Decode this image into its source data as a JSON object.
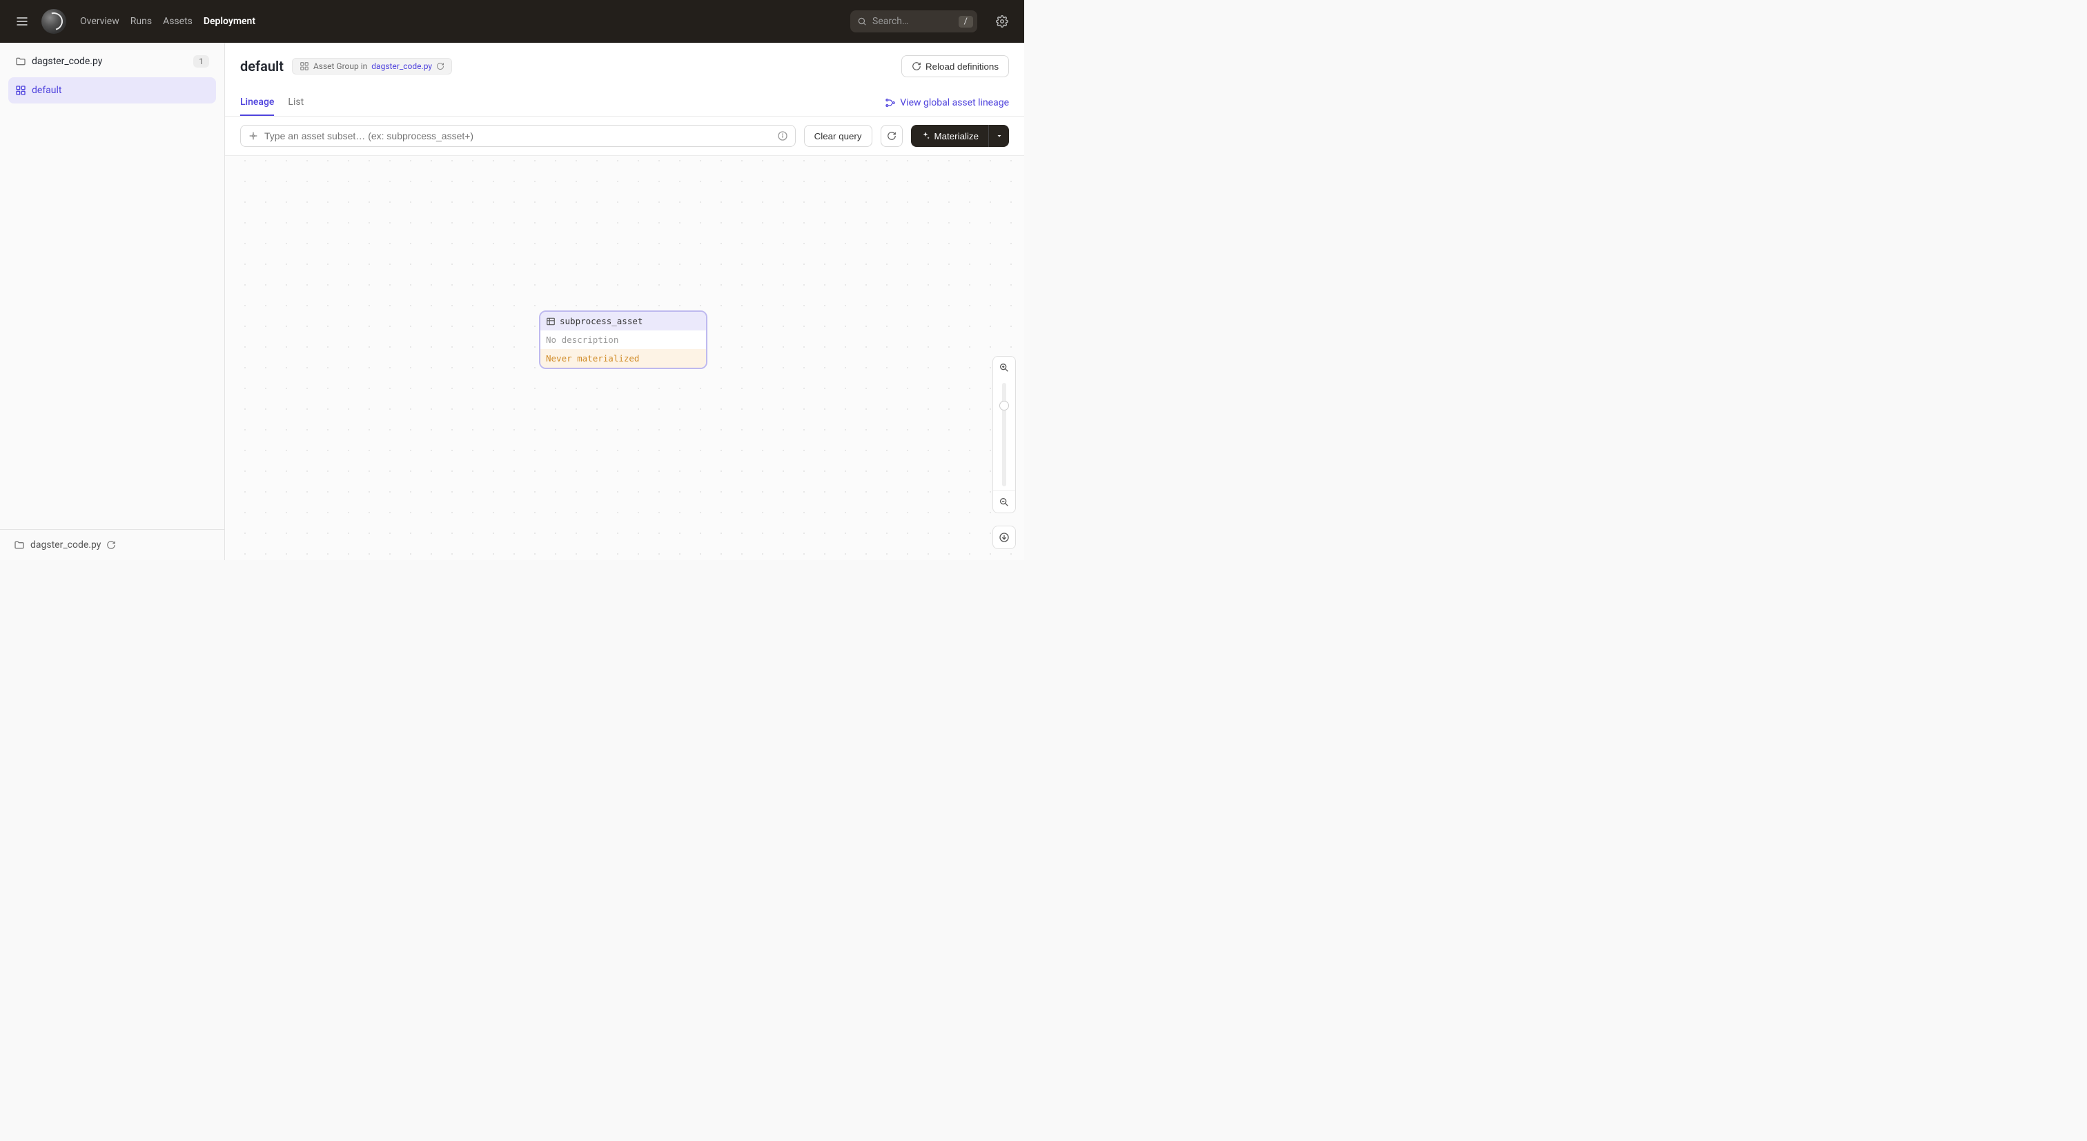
{
  "header": {
    "nav": {
      "overview": "Overview",
      "runs": "Runs",
      "assets": "Assets",
      "deployment": "Deployment"
    },
    "search_placeholder": "Search…",
    "search_shortcut": "/"
  },
  "sidebar": {
    "code_location": {
      "name": "dagster_code.py",
      "count": "1"
    },
    "group": {
      "name": "default"
    },
    "footer_code_location": "dagster_code.py"
  },
  "main": {
    "title": "default",
    "asset_group_prefix": "Asset Group in",
    "asset_group_link": "dagster_code.py",
    "reload_label": "Reload definitions",
    "tabs": {
      "lineage": "Lineage",
      "list": "List"
    },
    "global_lineage": "View global asset lineage",
    "query": {
      "placeholder": "Type an asset subset… (ex: subprocess_asset+)",
      "clear_label": "Clear query",
      "materialize_label": "Materialize"
    },
    "node": {
      "name": "subprocess_asset",
      "description": "No description",
      "status": "Never materialized"
    }
  }
}
